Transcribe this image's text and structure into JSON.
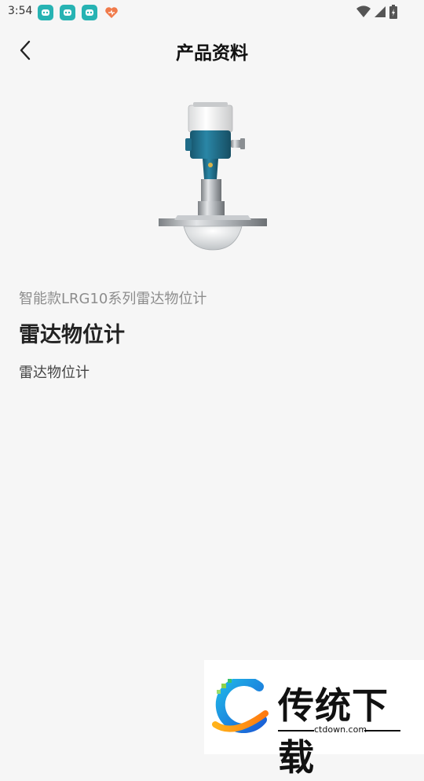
{
  "status_bar": {
    "time": "3:54",
    "notification_icons": [
      "app-icon",
      "app-icon",
      "app-icon",
      "heart-app-icon"
    ],
    "system_icons": [
      "wifi-icon",
      "signal-icon",
      "battery-charging-icon"
    ]
  },
  "header": {
    "back_icon": "chevron-left-icon",
    "title": "产品资料"
  },
  "product": {
    "image": "radar-level-meter-image",
    "series": "智能款LRG10系列雷达物位计",
    "name": "雷达物位计",
    "description": "雷达物位计"
  },
  "watermark": {
    "logo": "ctdown-logo",
    "text": "传统下载",
    "url": "ctdown.com"
  },
  "colors": {
    "background": "#f6f6f6",
    "notification_accent": "#27b3b3",
    "device_body": "#1e6f8c",
    "series_text": "#8d8d8d"
  }
}
